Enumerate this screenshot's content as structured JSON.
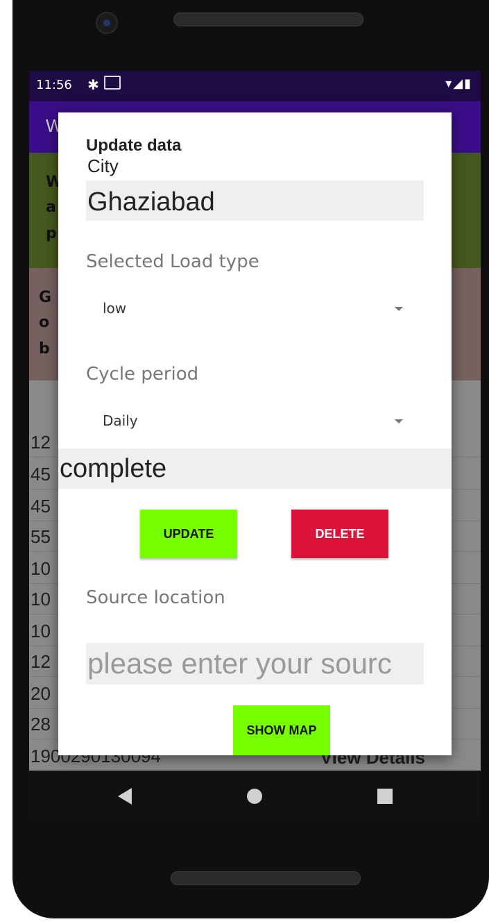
{
  "status_bar": {
    "time": "11:56",
    "gear_icon": "gear-icon",
    "mail_icon": "mail-icon",
    "system_icons": "▾◢▮"
  },
  "app_bar": {
    "title_partial": "W"
  },
  "background_cards": {
    "green_lines": [
      "W",
      "a",
      "p"
    ],
    "pink_lines": [
      "G",
      "o",
      "b"
    ]
  },
  "list_rows": [
    {
      "id": "12",
      "action": ""
    },
    {
      "id": "45",
      "action": ""
    },
    {
      "id": "45",
      "action": ""
    },
    {
      "id": "55",
      "action": ""
    },
    {
      "id": "10",
      "action": ""
    },
    {
      "id": "10",
      "action": ""
    },
    {
      "id": "10",
      "action": ""
    },
    {
      "id": "12",
      "action": ""
    },
    {
      "id": "20",
      "action": ""
    },
    {
      "id": "28",
      "action": ""
    },
    {
      "id": "1900290130094",
      "action": "View Details"
    }
  ],
  "dialog": {
    "title": "Update data",
    "city_label": "City",
    "city_value": "Ghaziabad",
    "load_type_label": "Selected Load type",
    "load_type_value": "low",
    "cycle_label": "Cycle period",
    "cycle_value": "Daily",
    "status_value": "complete",
    "update_button": "UPDATE",
    "delete_button": "DELETE",
    "source_label": "Source location",
    "source_placeholder": "please enter your sourc",
    "show_map_button": "SHOW MAP"
  },
  "colors": {
    "accent_green": "#77ff00",
    "delete_red": "#dc143c",
    "app_bar": "#3a0e88",
    "status_bar": "#1c0b44"
  }
}
